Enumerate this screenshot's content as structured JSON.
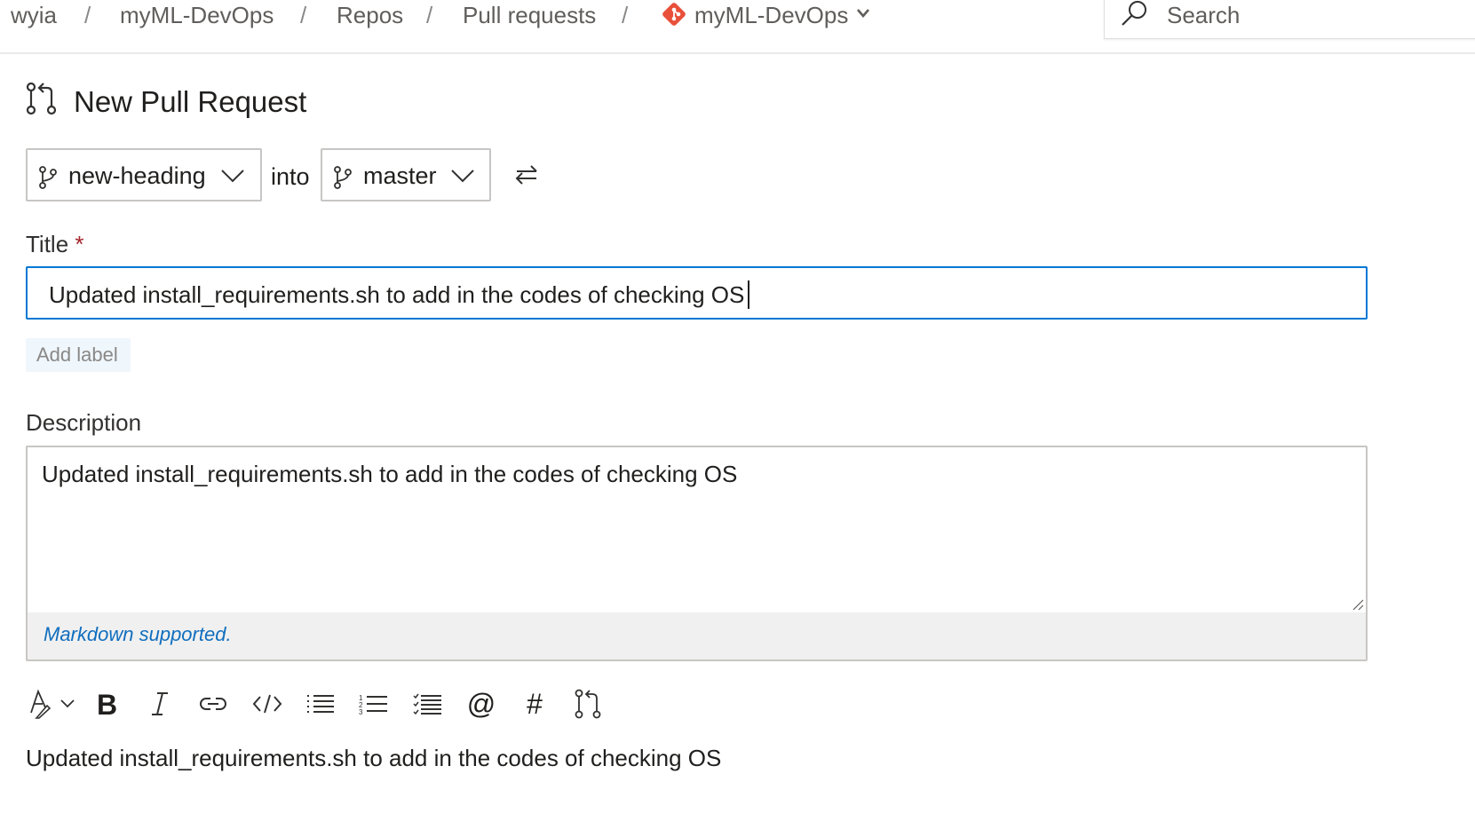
{
  "breadcrumb": {
    "org": "wyia",
    "project": "myML-DevOps",
    "section": "Repos",
    "page": "Pull requests",
    "repo": "myML-DevOps",
    "separator": "/"
  },
  "search": {
    "placeholder": "Search"
  },
  "header": {
    "title": "New Pull Request"
  },
  "branches": {
    "source": "new-heading",
    "into_label": "into",
    "target": "master"
  },
  "form": {
    "title_label": "Title",
    "required_mark": "*",
    "title_value": "Updated install_requirements.sh to add in the codes of checking OS",
    "add_label": "Add label",
    "description_label": "Description",
    "description_value": "Updated install_requirements.sh to add in the codes of checking OS",
    "markdown_note": "Markdown supported."
  },
  "toolbar": {
    "items": [
      "format-icon",
      "bold-icon",
      "italic-icon",
      "link-icon",
      "code-icon",
      "bulleted-list-icon",
      "numbered-list-icon",
      "task-list-icon",
      "mention-icon",
      "work-item-icon",
      "pull-request-icon"
    ],
    "mention": "@",
    "hash": "#"
  },
  "preview": {
    "text": "Updated install_requirements.sh to add in the codes of checking OS"
  },
  "colors": {
    "accent": "#0078d4",
    "repo_icon": "#e8503a",
    "required": "#a4262c",
    "link": "#106ebe"
  }
}
